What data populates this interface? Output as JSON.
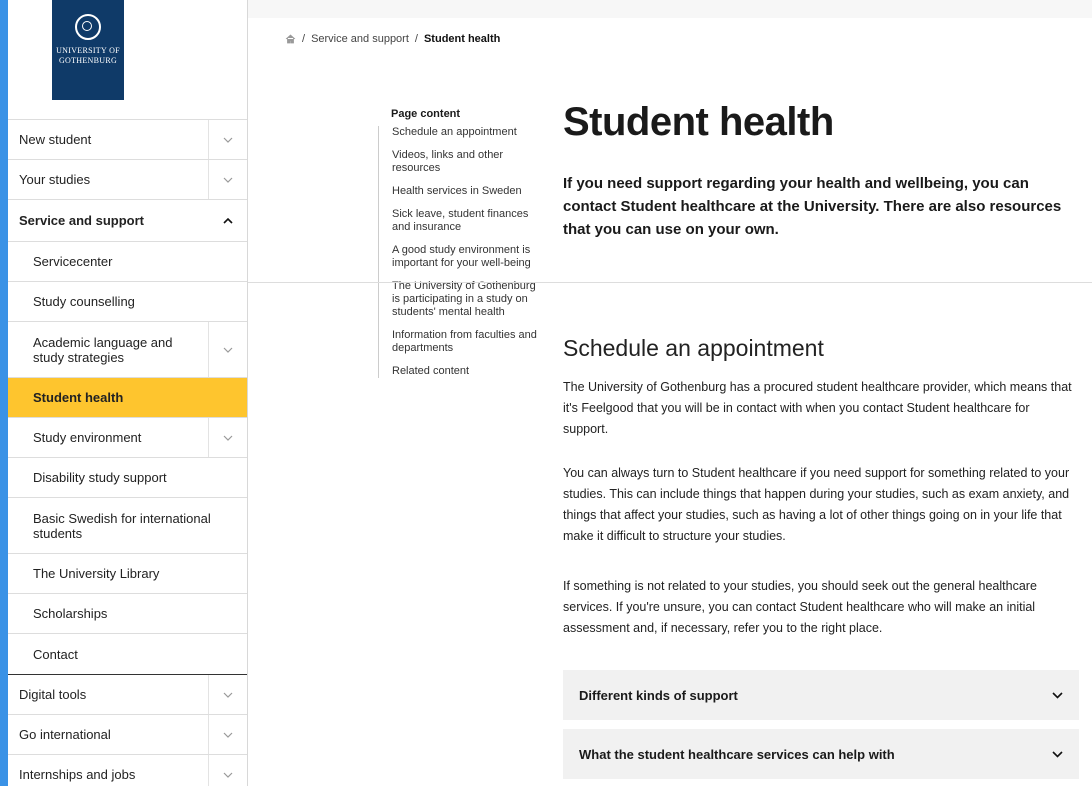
{
  "logo": {
    "line1": "UNIVERSITY OF",
    "line2": "GOTHENBURG"
  },
  "sidebar": {
    "items": [
      {
        "label": "New student",
        "expandable": true
      },
      {
        "label": "Your studies",
        "expandable": true
      },
      {
        "label": "Service and support",
        "expanded": true
      },
      {
        "label": "Servicecenter"
      },
      {
        "label": "Study counselling"
      },
      {
        "label": "Academic language and study strategies",
        "expandable": true
      },
      {
        "label": "Student health",
        "active": true
      },
      {
        "label": "Study environment",
        "expandable": true
      },
      {
        "label": "Disability study support"
      },
      {
        "label": "Basic Swedish for international students"
      },
      {
        "label": "The University Library"
      },
      {
        "label": "Scholarships"
      },
      {
        "label": "Contact"
      },
      {
        "label": "Digital tools",
        "expandable": true
      },
      {
        "label": "Go international",
        "expandable": true
      },
      {
        "label": "Internships and jobs",
        "expandable": true
      }
    ]
  },
  "breadcrumb": {
    "sep1": "/",
    "item1": "Service and support",
    "sep2": "/",
    "current": "Student health"
  },
  "toc": {
    "heading": "Page content",
    "items": [
      "Schedule an appointment",
      "Videos, links and other resources",
      "Health services in Sweden",
      "Sick leave, student finances and insurance",
      "A good study environment is important for your well-being",
      "The University of Gothenburg is participating in a study on students' mental health",
      "Information from faculties and departments",
      "Related content"
    ]
  },
  "main": {
    "title": "Student health",
    "intro": "If you need support regarding your health and wellbeing, you can contact Student healthcare at the University. There are also resources that you can use on your own.",
    "section_title": "Schedule an appointment",
    "p1": "The University of Gothenburg has a procured student healthcare provider, which means that it's Feelgood that you will be in contact with when you contact Student healthcare for support.",
    "p2": "You can always turn to Student healthcare if you need support for something related to your studies. This can include things that happen during your studies, such as exam anxiety, and things that affect your studies, such as having a lot of other things going on in your life that make it difficult to structure your studies.",
    "p3": "If something is not related to your studies, you should seek out the general healthcare services. If you're unsure, you can contact Student healthcare who will make an initial assessment and, if necessary, refer you to the right place.",
    "accordions": [
      "Different kinds of support",
      "What the student healthcare services can help with"
    ]
  },
  "colors": {
    "active_bg": "#fec52e",
    "logo_bg": "#0f3a68",
    "accordion_bg": "#f1f1f1"
  }
}
